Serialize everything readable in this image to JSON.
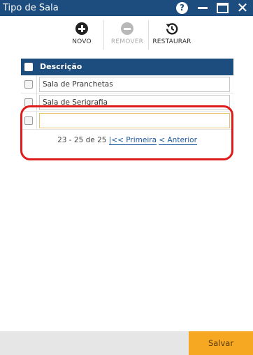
{
  "window": {
    "title": "Tipo de Sala",
    "help_icon": "?",
    "close_icon": "✕"
  },
  "toolbar": {
    "novo_label": "NOVO",
    "remover_label": "REMOVER",
    "restaurar_label": "RESTAURAR"
  },
  "grid": {
    "header_label": "Descrição",
    "rows": [
      {
        "value": "Sala de Pranchetas"
      },
      {
        "value": "Sala de Serigrafia"
      },
      {
        "value": ""
      }
    ]
  },
  "pager": {
    "range_text": "23 - 25 de 25",
    "first_link": "|<< Primeira",
    "prev_link": "< Anterior"
  },
  "footer": {
    "save_label": "Salvar"
  },
  "colors": {
    "header_blue": "#1d4d7e",
    "accent_orange": "#f7a823",
    "highlight_red": "#e01b1b"
  }
}
